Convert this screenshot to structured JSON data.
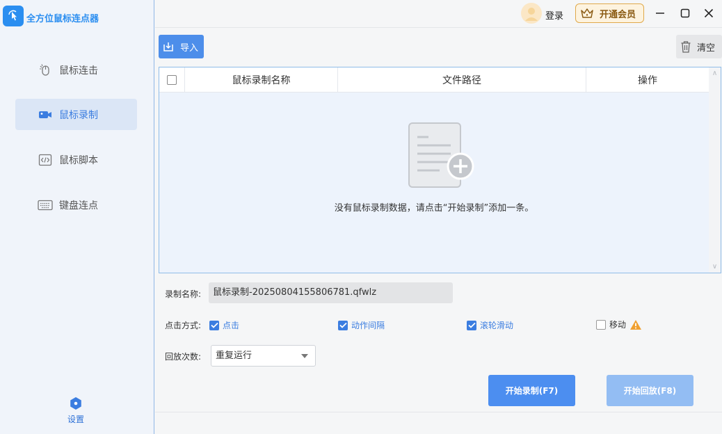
{
  "app": {
    "title": "全方位鼠标连点器"
  },
  "sidebar": {
    "items": [
      {
        "label": "鼠标连击",
        "icon": "mouse-click-icon"
      },
      {
        "label": "鼠标录制",
        "icon": "video-camera-icon",
        "active": true
      },
      {
        "label": "鼠标脚本",
        "icon": "code-script-icon"
      },
      {
        "label": "键盘连点",
        "icon": "keyboard-icon"
      }
    ],
    "settings_label": "设置"
  },
  "titlebar": {
    "login_label": "登录",
    "vip_label": "开通会员"
  },
  "toolbar": {
    "import_label": "导入",
    "clear_label": "清空"
  },
  "table": {
    "columns": [
      "鼠标录制名称",
      "文件路径",
      "操作"
    ],
    "empty_text": "没有鼠标录制数据，请点击“开始录制”添加一条。"
  },
  "form": {
    "name_label": "录制名称:",
    "name_value": "鼠标录制-20250804155806781.qfwlz",
    "click_mode_label": "点击方式:",
    "options": [
      {
        "label": "点击",
        "checked": true
      },
      {
        "label": "动作间隔",
        "checked": true
      },
      {
        "label": "滚轮滑动",
        "checked": true
      },
      {
        "label": "移动",
        "checked": false
      }
    ],
    "repeat_label": "回放次数:",
    "repeat_value": "重复运行"
  },
  "actions": {
    "record_label": "开始录制(F7)",
    "play_label": "开始回放(F8)"
  },
  "colors": {
    "accent": "#3b7de0",
    "vip_border": "#e0a94a",
    "warning": "#f0a030"
  }
}
